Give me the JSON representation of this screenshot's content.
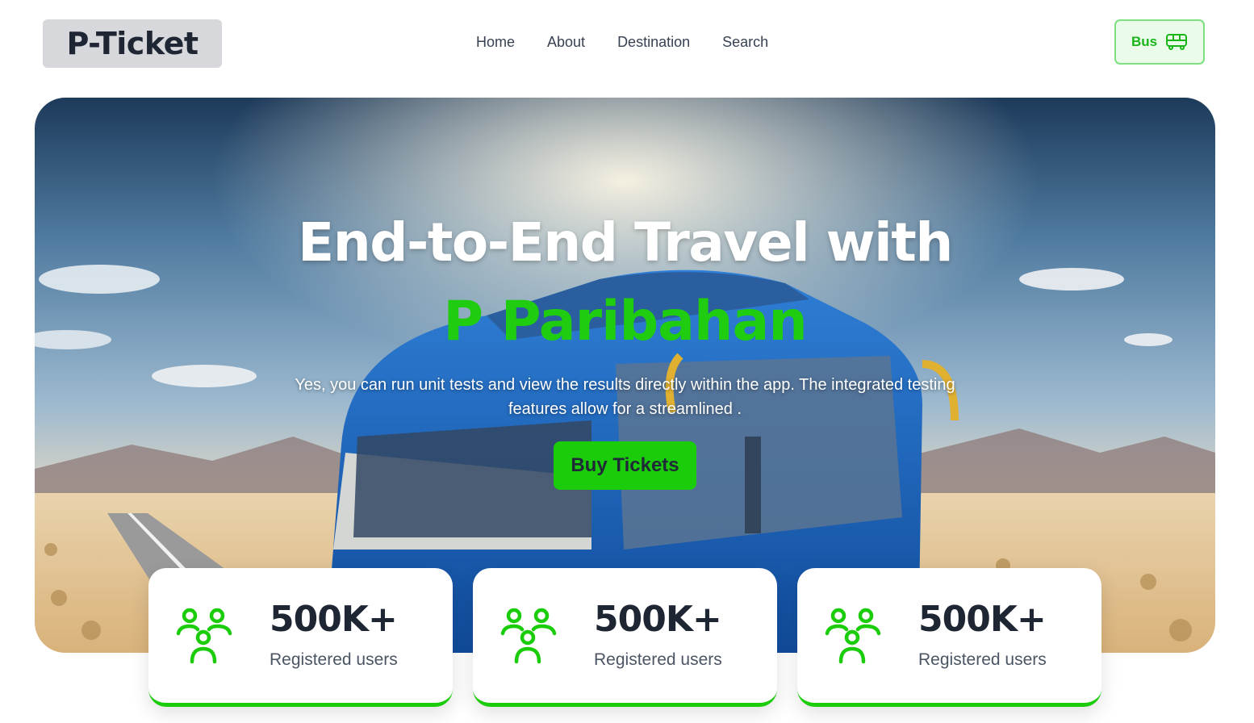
{
  "brand": {
    "logo_text": "P-Ticket"
  },
  "nav": {
    "items": [
      {
        "label": "Home"
      },
      {
        "label": "About"
      },
      {
        "label": "Destination"
      },
      {
        "label": "Search"
      }
    ]
  },
  "header": {
    "bus_button_label": "Bus",
    "bus_icon": "bus-icon"
  },
  "hero": {
    "title": "End-to-End Travel with",
    "accent": "P Paribahan",
    "description": "Yes, you can run unit tests and view the results directly within the app. The integrated testing features allow for a streamlined .",
    "cta_label": "Buy Tickets"
  },
  "stats": [
    {
      "value": "500K+",
      "label": "Registered users",
      "icon": "users-icon"
    },
    {
      "value": "500K+",
      "label": "Registered users",
      "icon": "users-icon"
    },
    {
      "value": "500K+",
      "label": "Registered users",
      "icon": "users-icon"
    }
  ],
  "colors": {
    "accent_green": "#1bcc0a",
    "dark_text": "#1e2533",
    "logo_bg": "#d6d8dc"
  }
}
